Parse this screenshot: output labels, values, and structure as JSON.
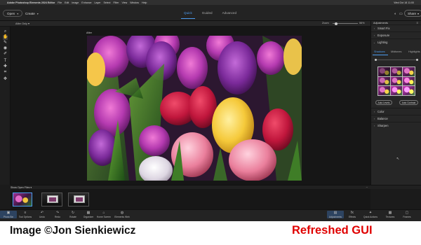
{
  "mac_menu": {
    "app_name": "Adobe Photoshop Elements 2024 Editor",
    "items": [
      "File",
      "Edit",
      "Image",
      "Enhance",
      "Layer",
      "Select",
      "Filter",
      "View",
      "Window",
      "Help"
    ],
    "clock": "Wed Oct 18 11:00"
  },
  "top_bar": {
    "open_label": "Open",
    "create_label": "Create",
    "modes": [
      "Quick",
      "Guided",
      "Advanced"
    ],
    "active_mode": "Quick",
    "share_label": "Share"
  },
  "options_bar": {
    "view": "After Only",
    "zoom_label": "Zoom",
    "zoom_value": "56%",
    "zoom_level": 0.1
  },
  "tools": {
    "icons": [
      "zoom-icon",
      "hand-icon",
      "quick-selection-icon",
      "red-eye-icon",
      "whiten-teeth-icon",
      "type-icon",
      "spot-healing-icon",
      "crop-icon",
      "move-icon"
    ],
    "glyphs": [
      "⌕",
      "✋",
      "✎",
      "◉",
      "✐",
      "T",
      "✚",
      "⌗",
      "✥"
    ],
    "active_index": 1
  },
  "canvas": {
    "label": "After"
  },
  "adjustments": {
    "title": "Adjustments",
    "sections": {
      "smart_fix": "Smart Fix",
      "exposure": "Exposure",
      "lighting": "Lighting",
      "color": "Color",
      "balance": "Balance",
      "sharpen": "Sharpen"
    },
    "lighting_tabs": [
      "Shadows",
      "Midtones",
      "Highlights"
    ],
    "active_lighting_tab": "Shadows",
    "auto_levels": "Auto Levels",
    "auto_contrast": "Auto Contrast"
  },
  "photo_bin": {
    "label": "Show Open Files",
    "thumbnails": 3
  },
  "bottom_bar": {
    "left": [
      {
        "label": "Photo Bin",
        "icon": "photo-bin-icon",
        "glyph": "▣"
      },
      {
        "label": "Tool Options",
        "icon": "tool-options-icon",
        "glyph": "≡"
      },
      {
        "label": "Undo",
        "icon": "undo-icon",
        "glyph": "↶"
      },
      {
        "label": "Redo",
        "icon": "redo-icon",
        "glyph": "↷"
      },
      {
        "label": "Rotate",
        "icon": "rotate-icon",
        "glyph": "↻"
      },
      {
        "label": "Organizer",
        "icon": "organizer-icon",
        "glyph": "▦"
      },
      {
        "label": "Home Screen",
        "icon": "home-icon",
        "glyph": "⌂"
      },
      {
        "label": "Elements Web",
        "icon": "elements-web-icon",
        "glyph": "◍"
      }
    ],
    "right": [
      {
        "label": "Adjustments",
        "icon": "adjustments-icon",
        "glyph": "▤"
      },
      {
        "label": "Effects",
        "icon": "effects-icon",
        "glyph": "fx"
      },
      {
        "label": "Quick Actions",
        "icon": "quick-actions-icon",
        "glyph": "✦"
      },
      {
        "label": "Textures",
        "icon": "textures-icon",
        "glyph": "▩"
      },
      {
        "label": "Frames",
        "icon": "frames-icon",
        "glyph": "▢"
      }
    ]
  },
  "credit": "Image ©Jon Sienkiewicz",
  "badge": "Refreshed GUI",
  "colors": {
    "accent": "#4d9cf0",
    "badge": "#e00000",
    "ui_bg": "#1b1b1b"
  }
}
